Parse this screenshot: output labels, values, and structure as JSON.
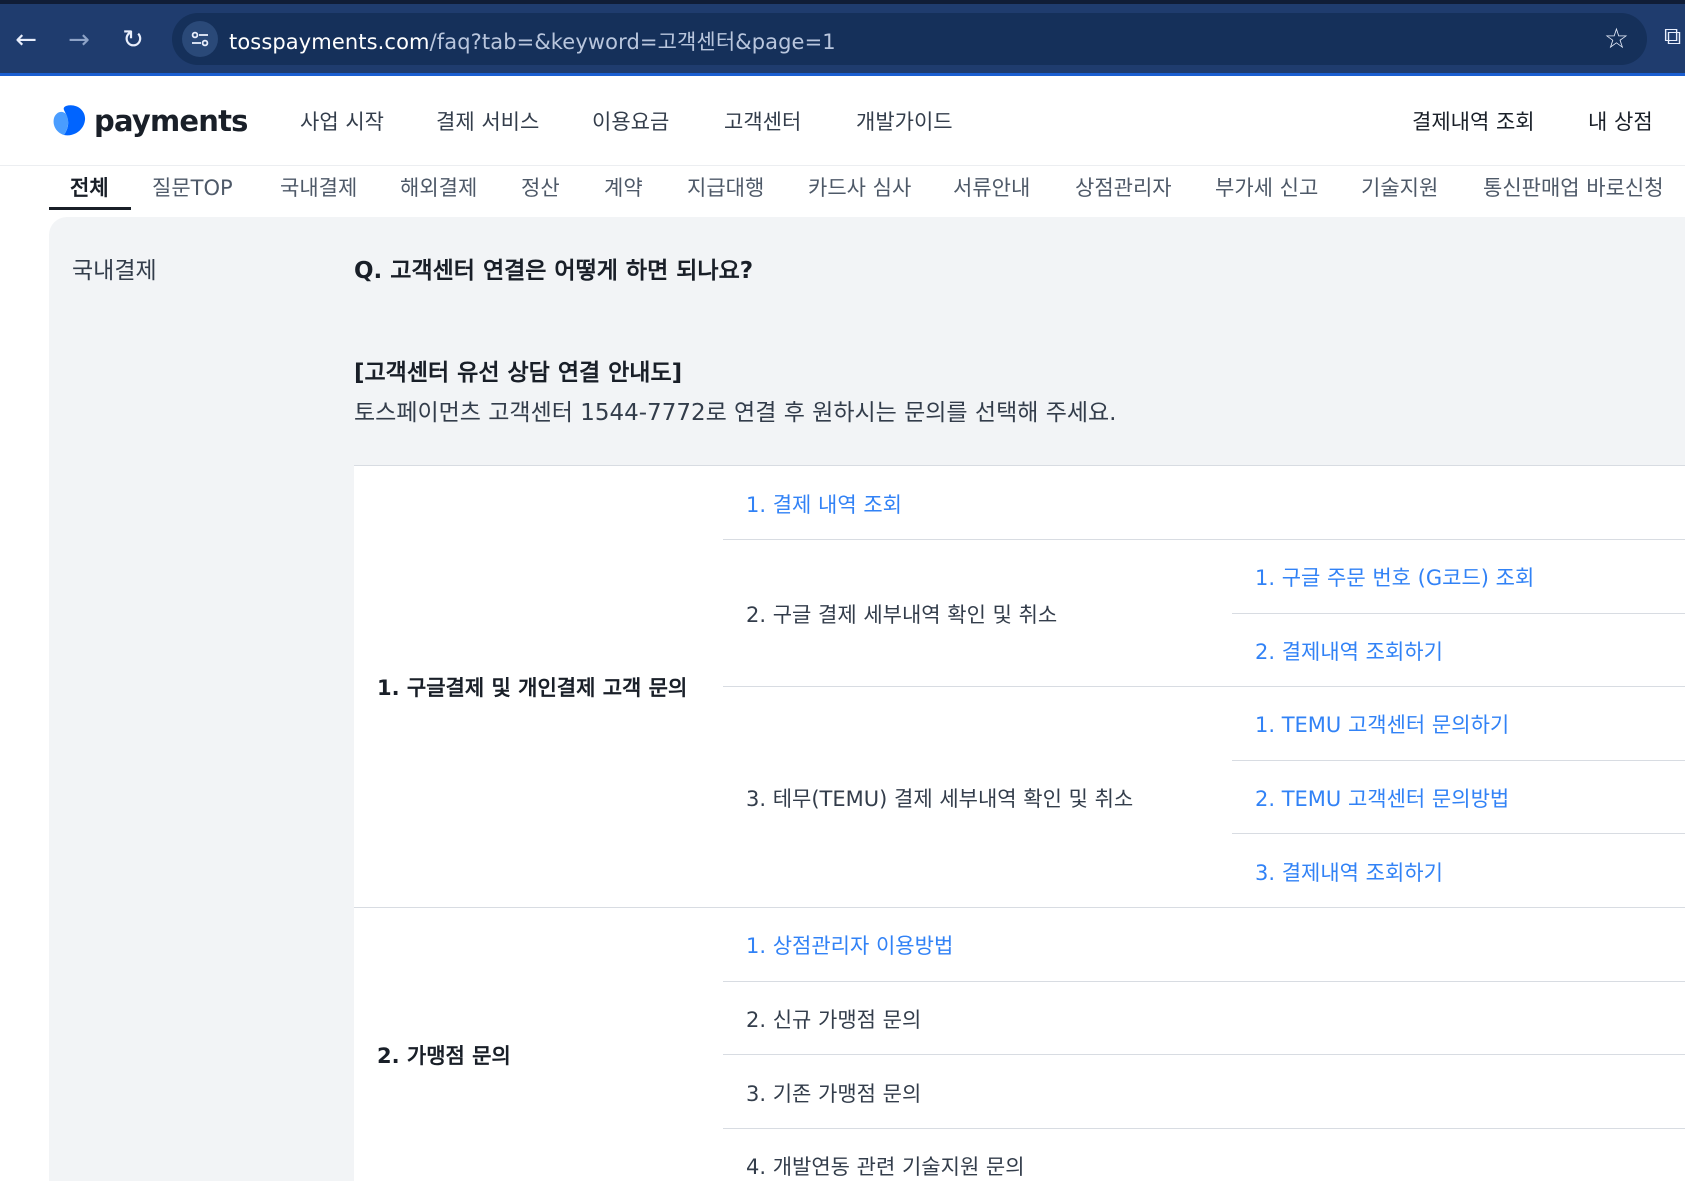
{
  "browser": {
    "url_host": "tosspayments.com",
    "url_rest": "/faq?tab=&keyword=고객센터&page=1"
  },
  "header": {
    "logo_text": "payments",
    "nav": [
      "사업 시작",
      "결제 서비스",
      "이용요금",
      "고객센터",
      "개발가이드"
    ],
    "right": [
      "결제내역 조회",
      "내 상점"
    ]
  },
  "tabs": [
    "전체",
    "질문TOP",
    "국내결제",
    "해외결제",
    "정산",
    "계약",
    "지급대행",
    "카드사 심사",
    "서류안내",
    "상점관리자",
    "부가세 신고",
    "기술지원",
    "통신판매업 바로신청"
  ],
  "faq": {
    "category": "국내결제",
    "question": "Q. 고객센터 연결은 어떻게 하면 되나요?",
    "notice_title": "[고객센터 유선 상담 연결 안내도]",
    "notice_text": "토스페이먼츠 고객센터 1544-7772로 연결 후 원하시는 문의를 선택해 주세요."
  },
  "guide": {
    "group1": {
      "title": "1. 구글결제 및 개인결제 고객 문의",
      "item1": "1. 결제 내역 조회",
      "item2": "2. 구글 결제 세부내역 확인 및 취소",
      "item2_sub": [
        "1. 구글 주문 번호 (G코드) 조회",
        "2. 결제내역 조회하기"
      ],
      "item3": "3. 테무(TEMU) 결제 세부내역 확인 및 취소",
      "item3_sub": [
        "1. TEMU 고객센터 문의하기",
        "2. TEMU 고객센터 문의방법",
        "3. 결제내역 조회하기"
      ]
    },
    "group2": {
      "title": "2. 가맹점 문의",
      "items": [
        "1. 상점관리자 이용방법",
        "2. 신규 가맹점 문의",
        "3. 기존 가맹점 문의",
        "4. 개발연동 관련 기술지원 문의"
      ]
    }
  }
}
